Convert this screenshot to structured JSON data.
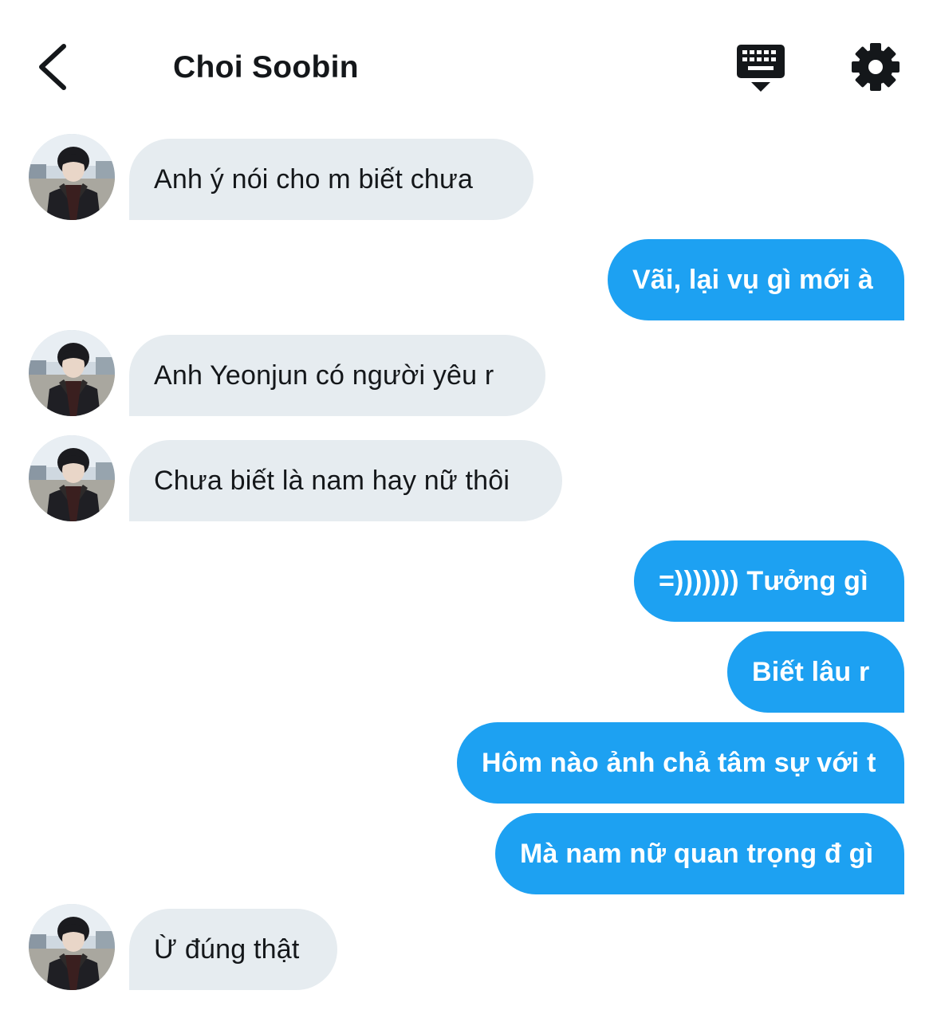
{
  "header": {
    "title": "Choi Soobin"
  },
  "icons": {
    "back": "chevron-left-icon",
    "keyboard": "keyboard-hide-icon",
    "settings": "gear-icon",
    "avatar": "avatar-photo"
  },
  "colors": {
    "outgoing_bubble": "#1da1f2",
    "incoming_bubble": "#e6ecf0",
    "text": "#14171a"
  },
  "messages": [
    {
      "side": "in",
      "text": "Anh ý nói cho m biết chưa"
    },
    {
      "side": "out",
      "text": "Vãi, lại vụ gì mới à"
    },
    {
      "side": "in",
      "text": "Anh Yeonjun có người yêu r"
    },
    {
      "side": "in",
      "text": "Chưa biết là nam hay nữ thôi"
    },
    {
      "side": "out",
      "text": "=))))))) Tưởng gì"
    },
    {
      "side": "out",
      "text": "Biết lâu r"
    },
    {
      "side": "out",
      "text": "Hôm nào ảnh chả tâm sự với t"
    },
    {
      "side": "out",
      "text": "Mà nam nữ quan trọng đ gì"
    },
    {
      "side": "in",
      "text": "Ừ đúng thật"
    }
  ]
}
